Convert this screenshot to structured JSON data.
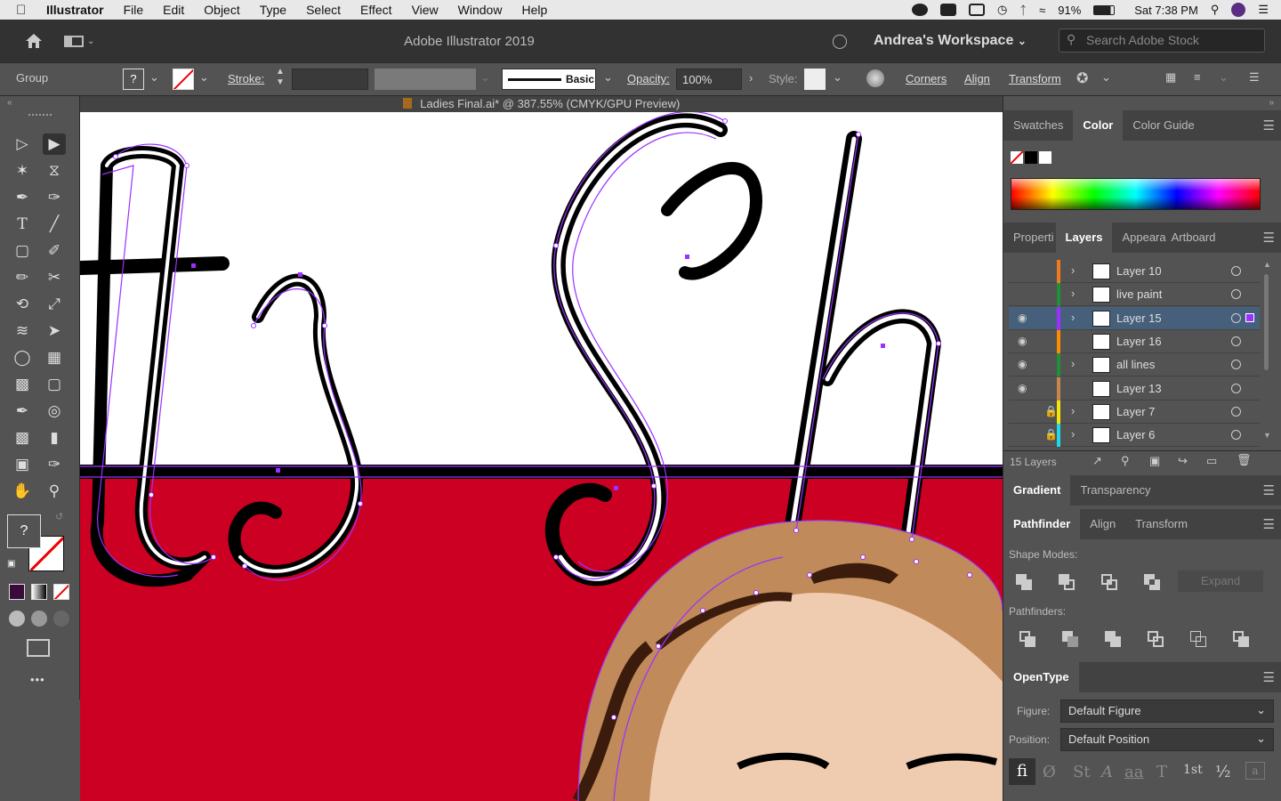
{
  "menubar": {
    "app": "Illustrator",
    "items": [
      "File",
      "Edit",
      "Object",
      "Type",
      "Select",
      "Effect",
      "View",
      "Window",
      "Help"
    ],
    "battery": "91%",
    "clock": "Sat 7:38 PM"
  },
  "titlebar": {
    "title": "Adobe Illustrator 2019",
    "workspace": "Andrea's Workspace",
    "search_placeholder": "Search Adobe Stock"
  },
  "control": {
    "selection_label": "Group",
    "fill_value": "?",
    "stroke_label": "Stroke:",
    "brush_label": "Basic",
    "opacity_label": "Opacity:",
    "opacity_value": "100%",
    "style_label": "Style:",
    "corners": "Corners",
    "align": "Align",
    "transform": "Transform"
  },
  "document": {
    "tab_title": "Ladies Final.ai* @ 387.55% (CMYK/GPU Preview)"
  },
  "toolbar": {
    "fill_question": "?",
    "more": "•••"
  },
  "color_panel": {
    "tabs": [
      "Swatches",
      "Color",
      "Color Guide"
    ],
    "active": "Color"
  },
  "layers_panel": {
    "tabs": [
      "Properties",
      "Layers",
      "Appearance",
      "Artboard"
    ],
    "tab_labels": [
      "Properti",
      "Layers",
      "Appeara",
      "Artboard"
    ],
    "active": "Layers",
    "layers": [
      {
        "name": "Layer 10",
        "color": "#f07a1f",
        "visible": false,
        "locked": false,
        "expandable": true,
        "selected": false
      },
      {
        "name": "live paint",
        "color": "#1f8f3a",
        "visible": false,
        "locked": false,
        "expandable": true,
        "selected": false
      },
      {
        "name": "Layer 15",
        "color": "#9b30ff",
        "visible": true,
        "locked": false,
        "expandable": true,
        "selected": true
      },
      {
        "name": "Layer 16",
        "color": "#ff8c00",
        "visible": true,
        "locked": false,
        "expandable": false,
        "selected": false
      },
      {
        "name": "all lines",
        "color": "#1f8f3a",
        "visible": true,
        "locked": false,
        "expandable": true,
        "selected": false
      },
      {
        "name": "Layer 13",
        "color": "#c8864a",
        "visible": true,
        "locked": false,
        "expandable": false,
        "selected": false
      },
      {
        "name": "Layer 7",
        "color": "#f5e60a",
        "visible": false,
        "locked": true,
        "expandable": true,
        "selected": false
      },
      {
        "name": "Layer 6",
        "color": "#1fd8e8",
        "visible": false,
        "locked": true,
        "expandable": true,
        "selected": false
      }
    ],
    "count": "15 Layers"
  },
  "gradient_panel": {
    "tabs": [
      "Gradient",
      "Transparency"
    ]
  },
  "pathfinder_panel": {
    "tabs": [
      "Pathfinder",
      "Align",
      "Transform"
    ],
    "shape_modes": "Shape Modes:",
    "pathfinders": "Pathfinders:",
    "expand": "Expand"
  },
  "opentype_panel": {
    "title": "OpenType",
    "figure_label": "Figure:",
    "figure_value": "Default Figure",
    "position_label": "Position:",
    "position_value": "Default Position",
    "glyphs": [
      "ﬁ",
      "Ø",
      "St",
      "A",
      "aa",
      "T",
      "1st",
      "½",
      "a"
    ]
  },
  "colors": {
    "canvas_red": "#cc0022",
    "selection_purple": "#9b30ff",
    "hair": "#c18a5a",
    "skin": "#efcbb0",
    "dark": "#3b1c0c"
  }
}
